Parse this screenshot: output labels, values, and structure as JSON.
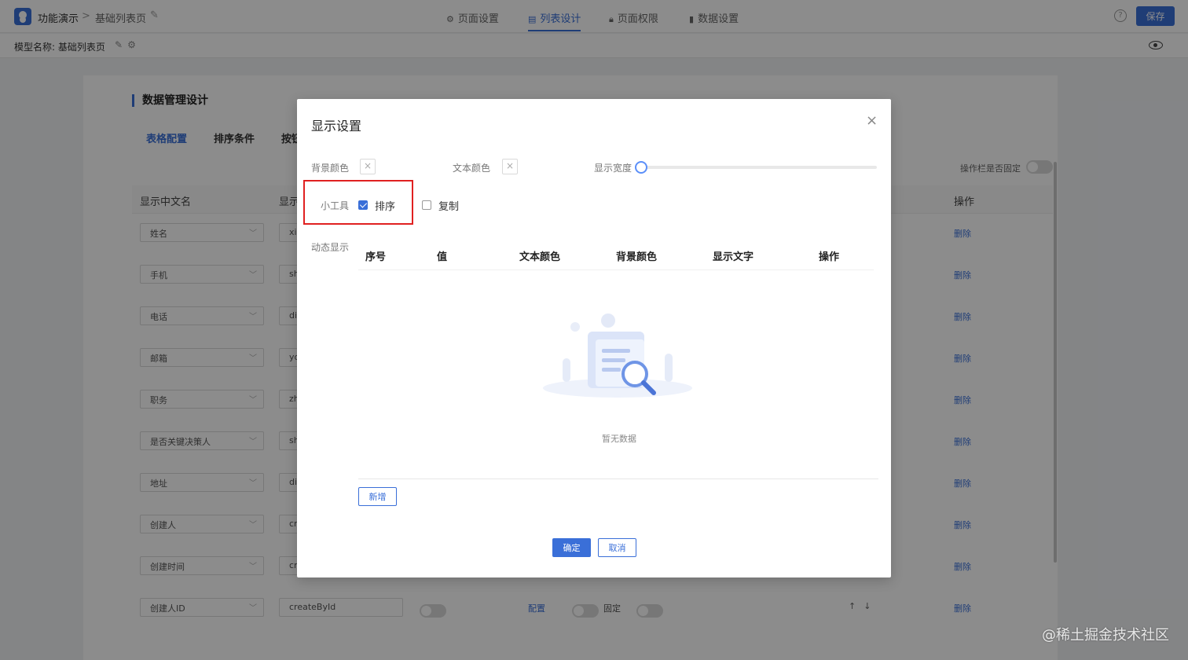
{
  "header": {
    "app_name": "功能演示",
    "breadcrumb_sep": ">",
    "page_name": "基础列表页",
    "tabs": [
      {
        "label": "页面设置",
        "icon": "gear-icon"
      },
      {
        "label": "列表设计",
        "icon": "table-icon",
        "active": true
      },
      {
        "label": "页面权限",
        "icon": "lock-icon"
      },
      {
        "label": "数据设置",
        "icon": "bar-chart-icon"
      }
    ],
    "help_symbol": "?",
    "save_label": "保存"
  },
  "subheader": {
    "model_label": "模型名称: 基础列表页"
  },
  "background": {
    "section_title": "数据管理设计",
    "tabs": [
      "表格配置",
      "排序条件",
      "按钮"
    ],
    "fixed_col_label": "操作栏是否固定",
    "columns": [
      "显示中文名",
      "显示",
      "操作"
    ],
    "rows": [
      {
        "name": "姓名",
        "field": "xi"
      },
      {
        "name": "手机",
        "field": "sh"
      },
      {
        "name": "电话",
        "field": "di"
      },
      {
        "name": "邮箱",
        "field": "yo"
      },
      {
        "name": "职务",
        "field": "zh"
      },
      {
        "name": "是否关键决策人",
        "field": "sh"
      },
      {
        "name": "地址",
        "field": "di"
      },
      {
        "name": "创建人",
        "field": "cr"
      },
      {
        "name": "创建时间",
        "field": "cr"
      },
      {
        "name": "创建人ID",
        "field": "createById"
      }
    ],
    "delete_label": "删除",
    "config_label": "配置",
    "fixed_label": "固定",
    "arrows": "↑↓"
  },
  "modal": {
    "title": "显示设置",
    "close_symbol": "×",
    "bg_color_label": "背景颜色",
    "text_color_label": "文本颜色",
    "width_label": "显示宽度",
    "tools_label": "小工具",
    "sort_label": "排序",
    "sort_checked": true,
    "copy_label": "复制",
    "copy_checked": false,
    "dynamic_label": "动态显示",
    "table_columns": [
      "序号",
      "值",
      "文本颜色",
      "背景颜色",
      "显示文字",
      "操作"
    ],
    "empty_text": "暂无数据",
    "add_label": "新增",
    "ok_label": "确定",
    "cancel_label": "取消"
  },
  "watermark": "@稀土掘金技术社区",
  "colors": {
    "primary": "#3a6fd8",
    "highlight_border": "#e02020"
  }
}
